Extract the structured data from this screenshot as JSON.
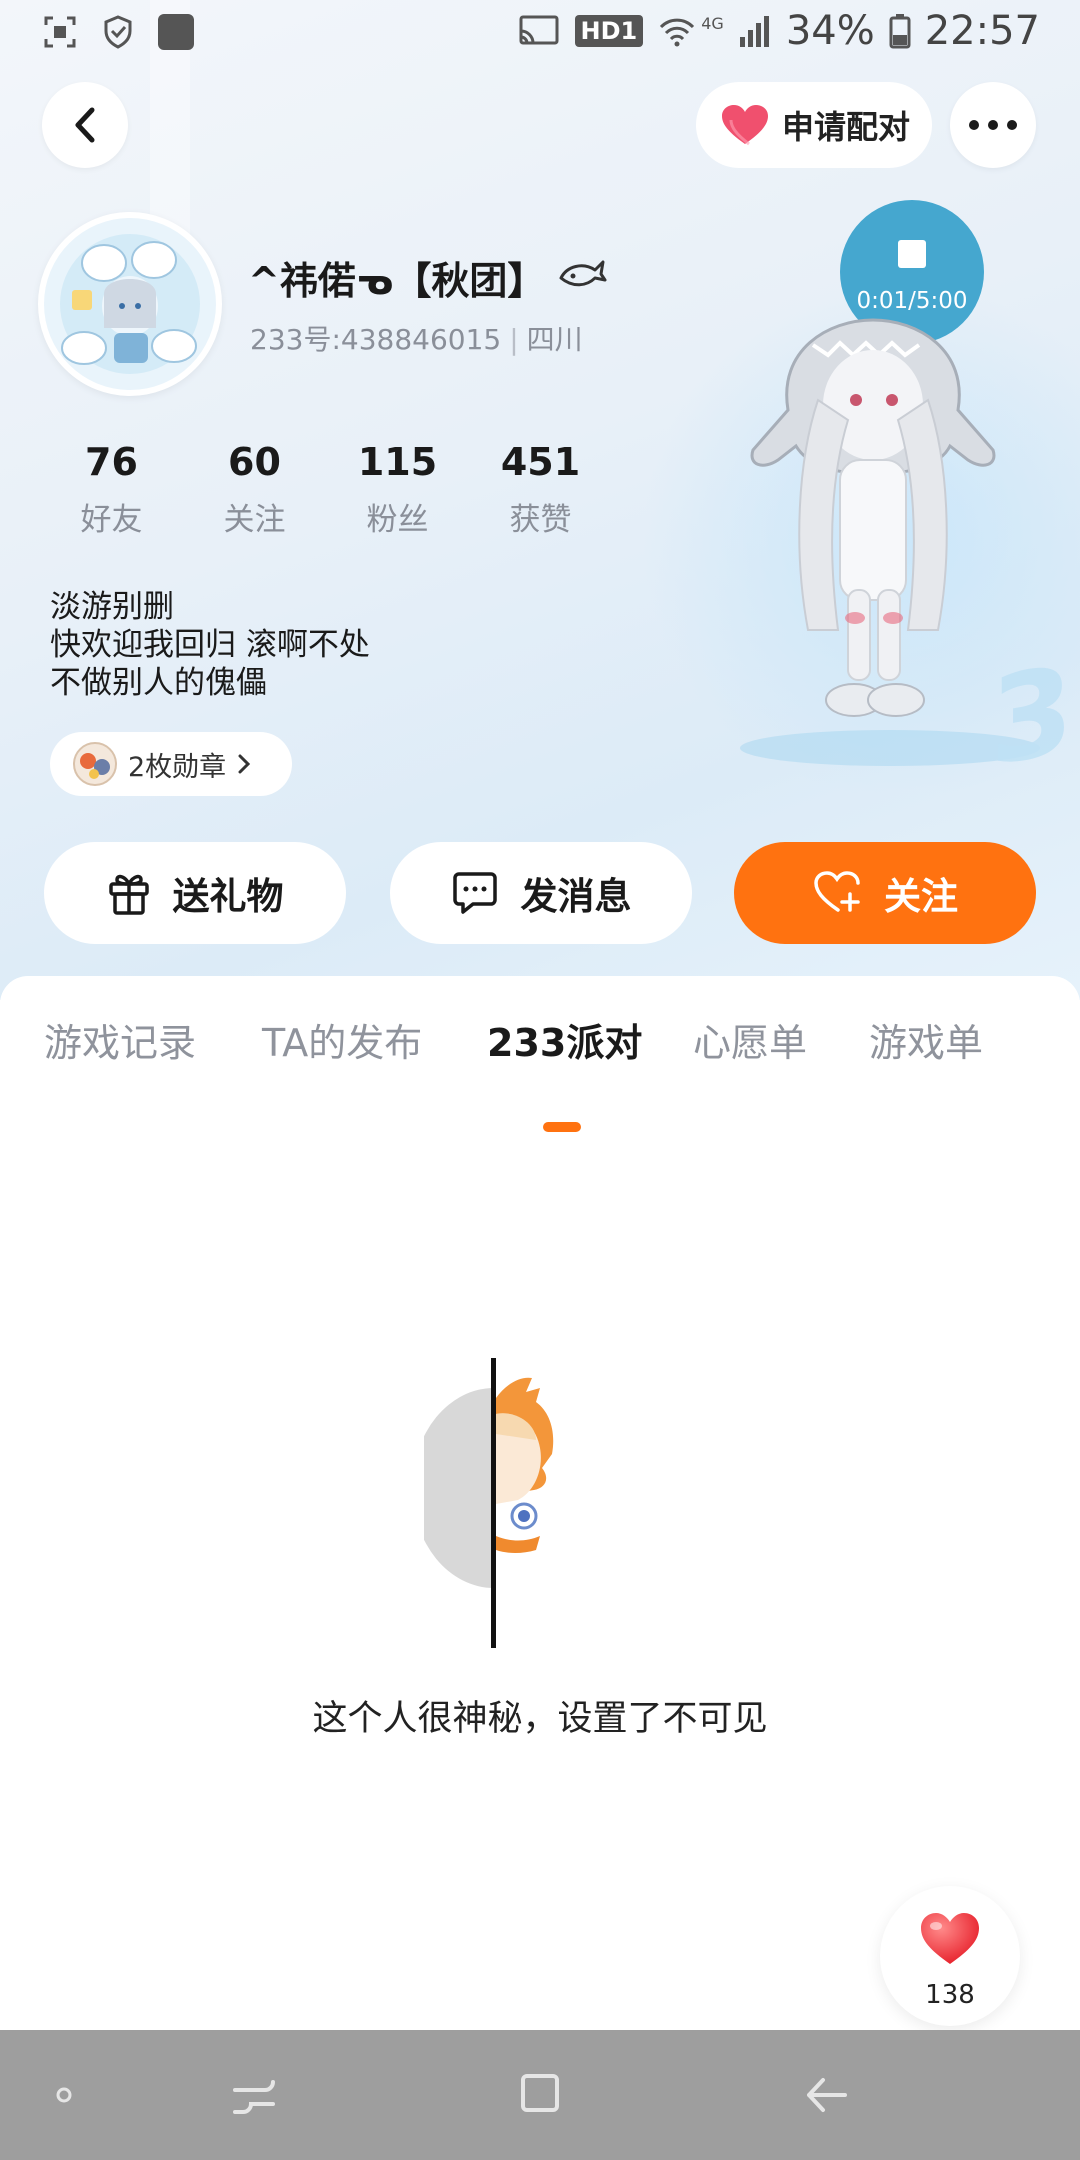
{
  "status_bar": {
    "battery": "34%",
    "time": "22:57",
    "network": "4G",
    "hd_label": "HD1"
  },
  "header": {
    "pair_label": "申请配对"
  },
  "profile": {
    "nickname": "^祎偌ᓀ【秋团】",
    "id_label": "233号:438846015",
    "location": "四川",
    "stats": [
      {
        "value": "76",
        "label": "好友"
      },
      {
        "value": "60",
        "label": "关注"
      },
      {
        "value": "115",
        "label": "粉丝"
      },
      {
        "value": "451",
        "label": "获赞"
      }
    ],
    "bio": [
      "淡游别删",
      "快欢迎我回归 滚啊不处",
      "不做别人的傀儡"
    ],
    "medal_label": "2枚勋章"
  },
  "voice": {
    "time": "0:01/5:00"
  },
  "actions": {
    "gift": "送礼物",
    "message": "发消息",
    "follow": "关注"
  },
  "tabs": [
    {
      "label": "游戏记录",
      "active": false
    },
    {
      "label": "TA的发布",
      "active": false
    },
    {
      "label": "233派对",
      "active": true
    },
    {
      "label": "心愿单",
      "active": false
    },
    {
      "label": "游戏单",
      "active": false
    }
  ],
  "empty_state": {
    "text": "这个人很神秘，设置了不可见"
  },
  "like": {
    "count": "138"
  },
  "colors": {
    "accent": "#ff7210",
    "voice": "#45a7cf",
    "heart": "#f0506e"
  }
}
